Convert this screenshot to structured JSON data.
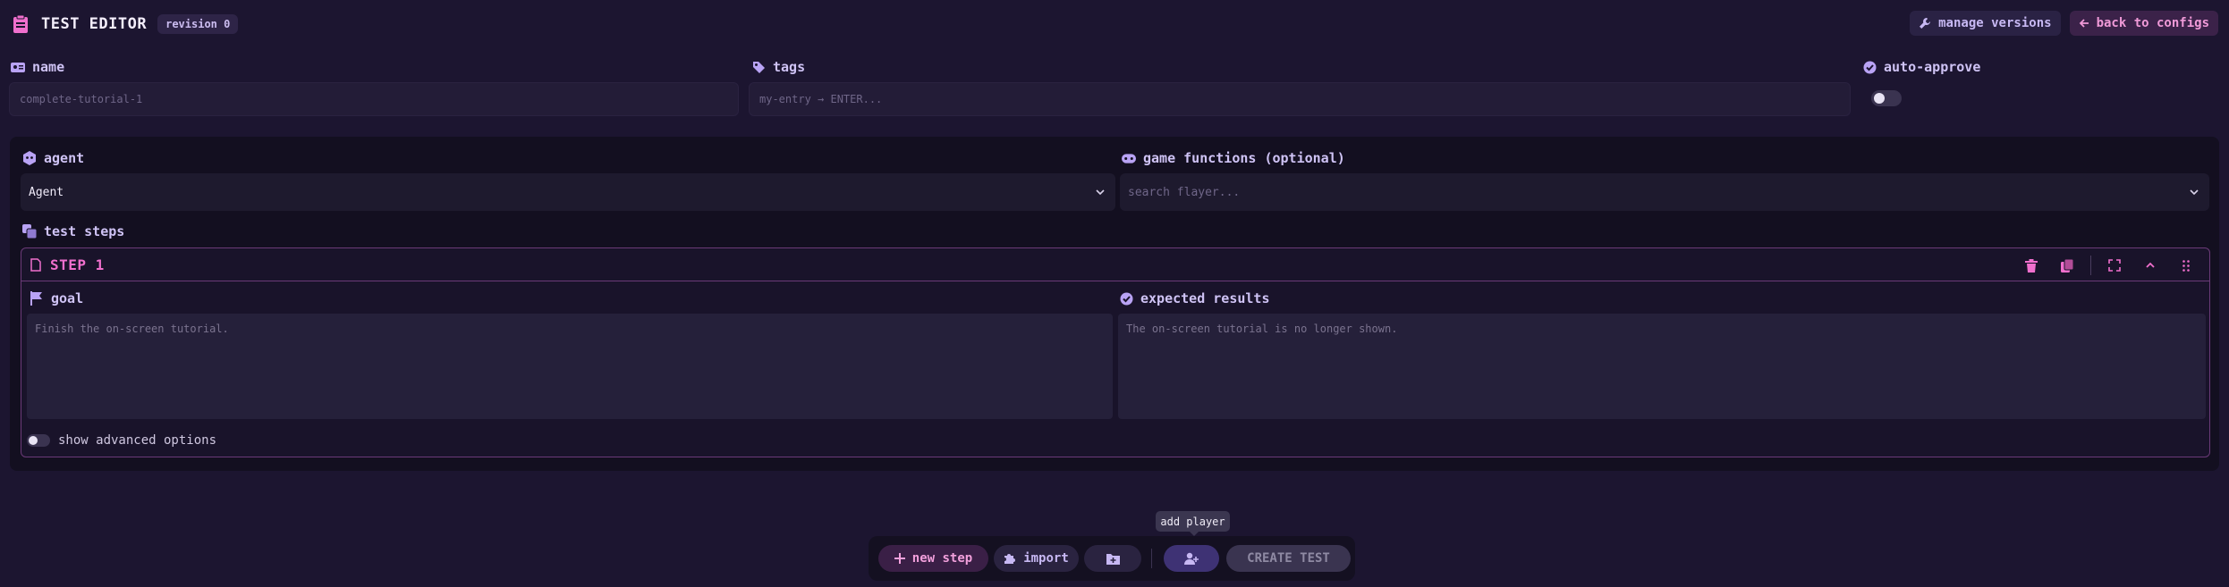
{
  "header": {
    "title": "TEST EDITOR",
    "revision_badge": "revision 0",
    "manage_versions_label": "manage versions",
    "back_label": "back to configs"
  },
  "fields": {
    "name": {
      "label": "name",
      "placeholder": "complete-tutorial-1"
    },
    "tags": {
      "label": "tags",
      "placeholder": "my-entry → ENTER..."
    },
    "auto_approve": {
      "label": "auto-approve",
      "enabled": false
    }
  },
  "agent": {
    "label": "agent",
    "selected": "Agent"
  },
  "game_functions": {
    "label": "game functions (optional)",
    "placeholder": "search flayer..."
  },
  "test_steps": {
    "label": "test steps",
    "steps": [
      {
        "title": "STEP 1",
        "goal_label": "goal",
        "goal_placeholder": "Finish the on-screen tutorial.",
        "expected_label": "expected results",
        "expected_placeholder": "The on-screen tutorial is no longer shown.",
        "advanced_label": "show advanced options",
        "advanced_enabled": false
      }
    ]
  },
  "toolbar": {
    "new_step_label": "new step",
    "import_label": "import",
    "tooltip": "add player",
    "create_label": "CREATE TEST"
  },
  "colors": {
    "background": "#1c1530",
    "accent_pink": "#f06fcd",
    "accent_violet": "#b9a3f5"
  },
  "icons": [
    "clipboard-icon",
    "wrench-icon",
    "arrow-left-icon",
    "id-card-icon",
    "tag-icon",
    "check-circle-icon",
    "robot-icon",
    "gamepad-icon",
    "layers-icon",
    "file-icon",
    "trash-icon",
    "copy-icon",
    "expand-icon",
    "chevron-up-icon",
    "drag-handle-icon",
    "flag-icon",
    "plus-icon",
    "puzzle-icon",
    "folder-plus-icon",
    "user-plus-icon",
    "chevron-down-icon"
  ]
}
